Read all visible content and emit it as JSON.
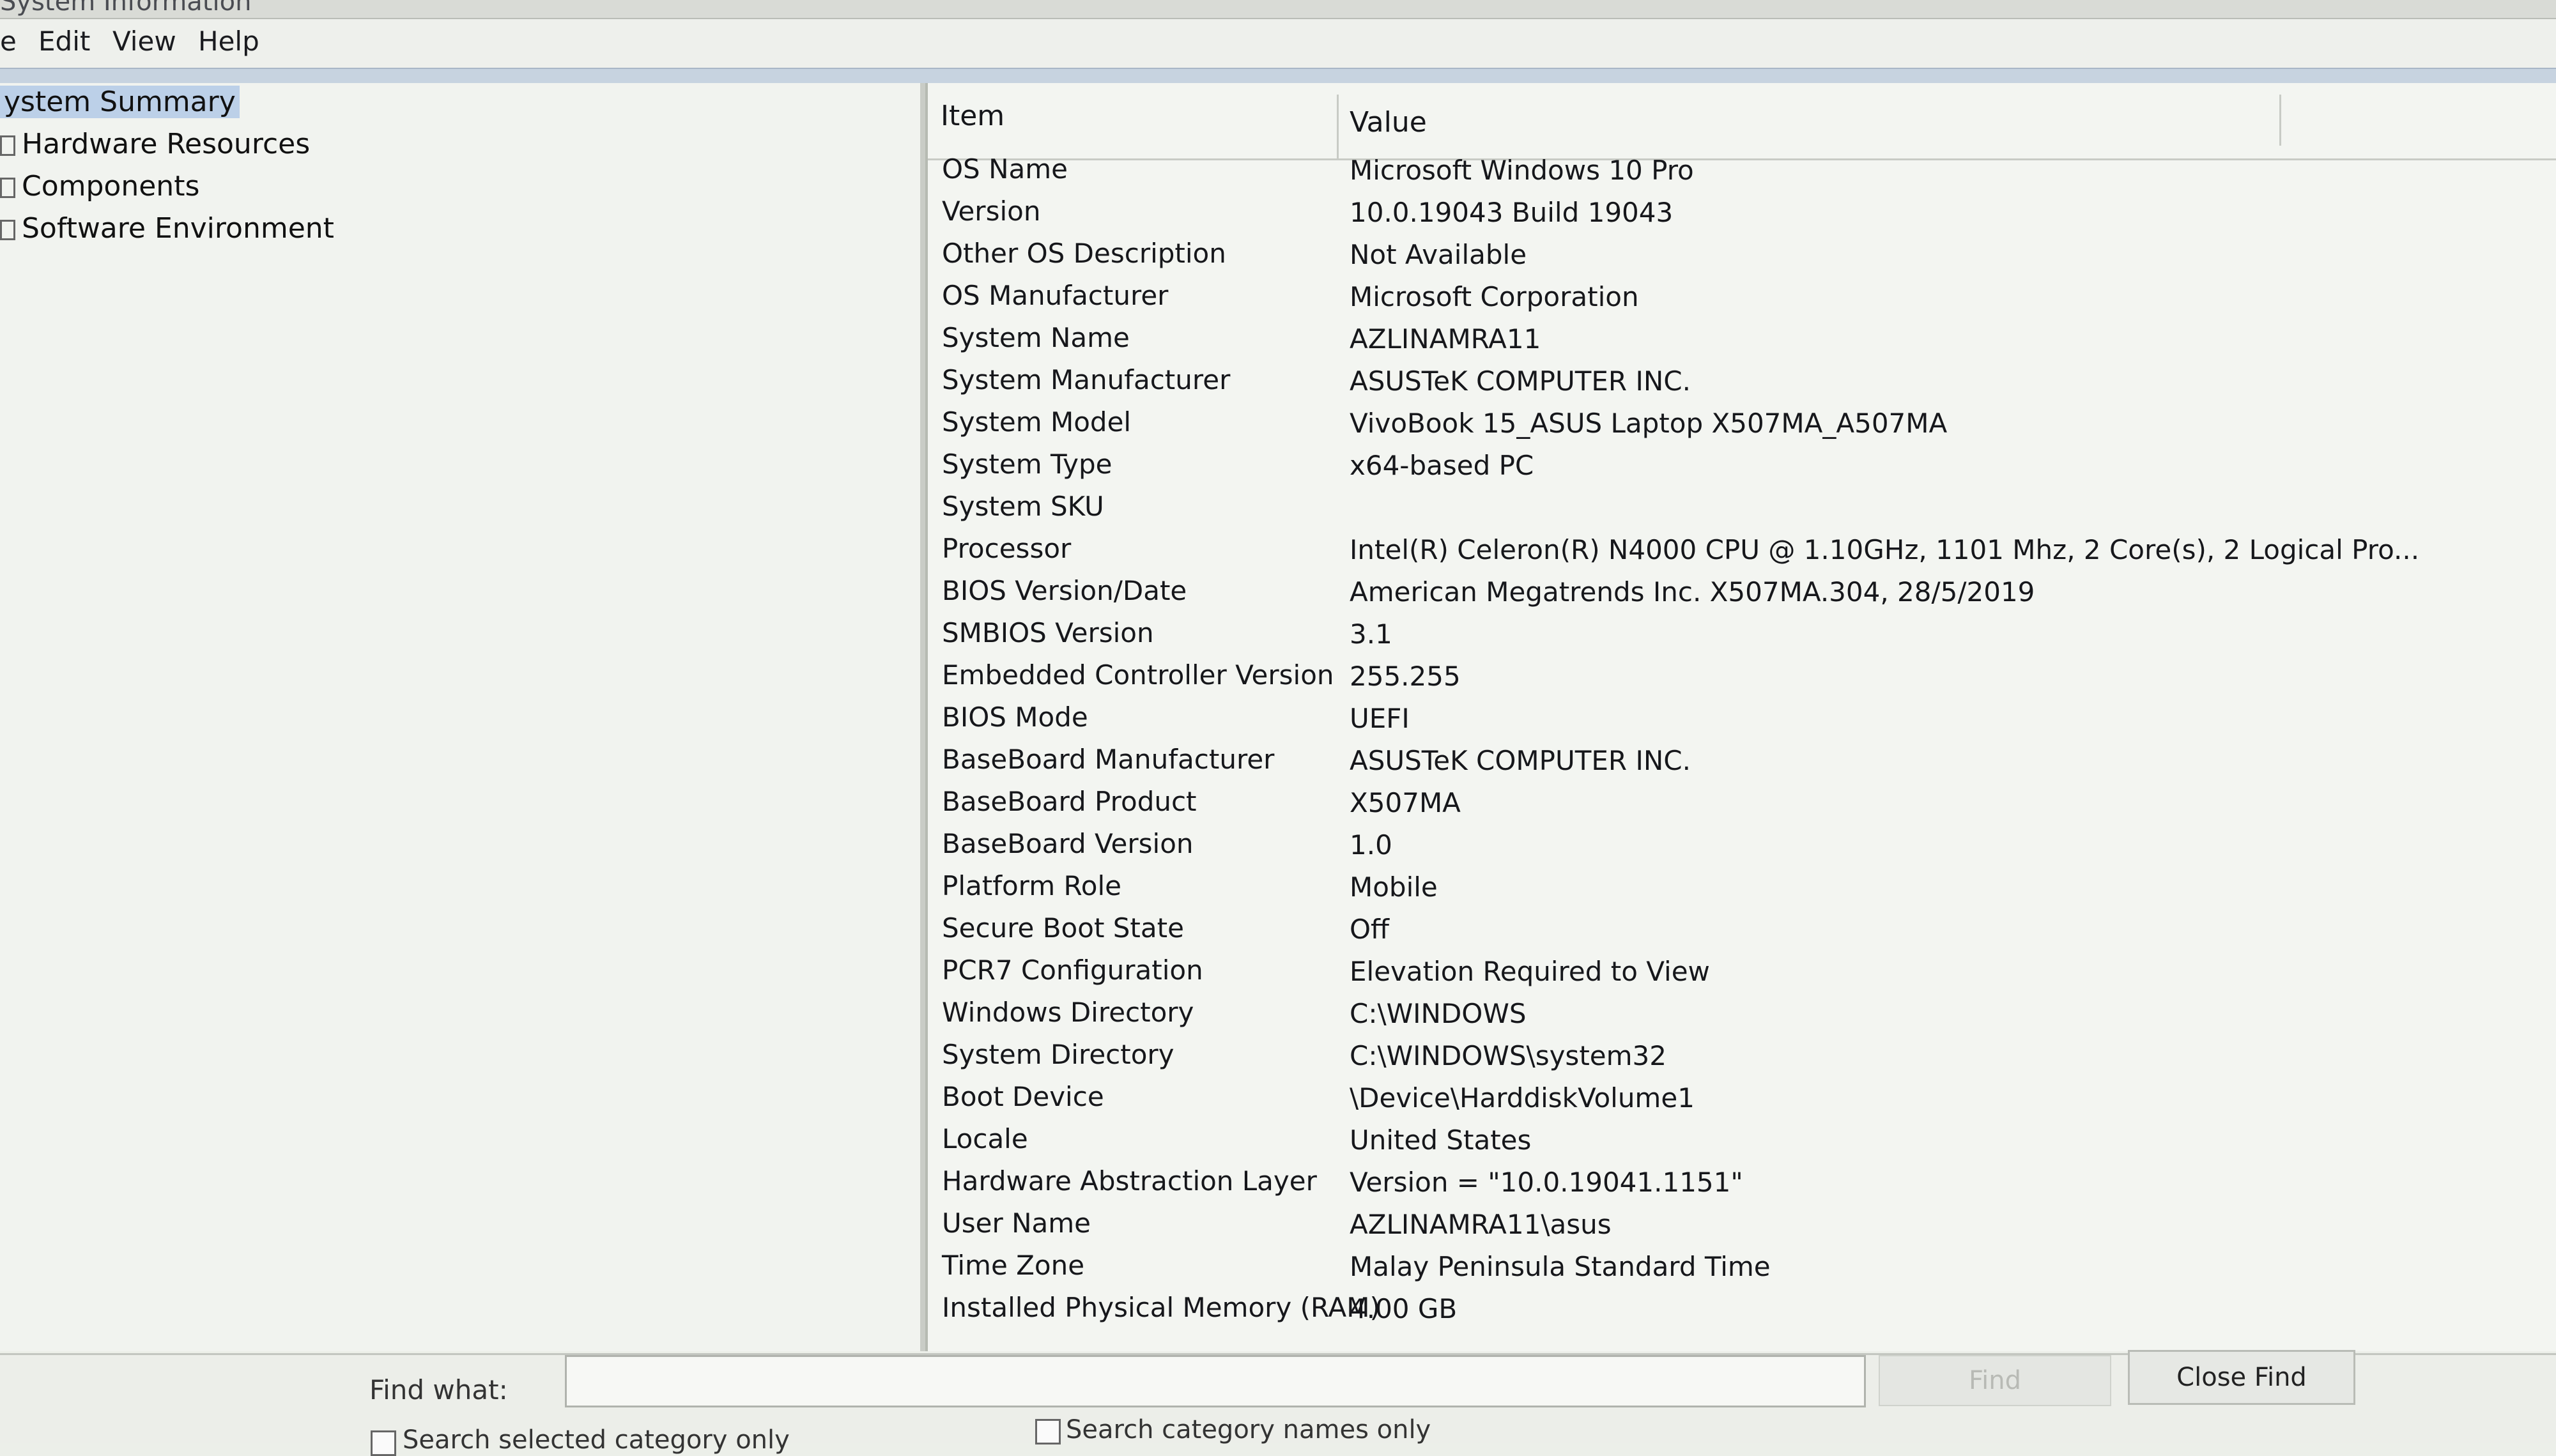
{
  "window": {
    "title": "System Information"
  },
  "menu": {
    "file": "e",
    "edit": "Edit",
    "view": "View",
    "help": "Help"
  },
  "tree": {
    "items": [
      {
        "label": "ystem Summary",
        "selected": true
      },
      {
        "label": "Hardware Resources",
        "selected": false
      },
      {
        "label": "Components",
        "selected": false
      },
      {
        "label": "Software Environment",
        "selected": false
      }
    ]
  },
  "list": {
    "headers": {
      "item": "Item",
      "value": "Value"
    },
    "rows": [
      {
        "item": "OS Name",
        "value": "Microsoft Windows 10 Pro"
      },
      {
        "item": "Version",
        "value": "10.0.19043 Build 19043"
      },
      {
        "item": "Other OS Description",
        "value": "Not Available"
      },
      {
        "item": "OS Manufacturer",
        "value": "Microsoft Corporation"
      },
      {
        "item": "System Name",
        "value": "AZLINAMRA11"
      },
      {
        "item": "System Manufacturer",
        "value": "ASUSTeK COMPUTER INC."
      },
      {
        "item": "System Model",
        "value": "VivoBook 15_ASUS Laptop X507MA_A507MA"
      },
      {
        "item": "System Type",
        "value": "x64-based PC"
      },
      {
        "item": "System SKU",
        "value": ""
      },
      {
        "item": "Processor",
        "value": "Intel(R) Celeron(R) N4000 CPU @ 1.10GHz, 1101 Mhz, 2 Core(s), 2 Logical Pro..."
      },
      {
        "item": "BIOS Version/Date",
        "value": "American Megatrends Inc. X507MA.304, 28/5/2019"
      },
      {
        "item": "SMBIOS Version",
        "value": "3.1"
      },
      {
        "item": "Embedded Controller Version",
        "value": "255.255"
      },
      {
        "item": "BIOS Mode",
        "value": "UEFI"
      },
      {
        "item": "BaseBoard Manufacturer",
        "value": "ASUSTeK COMPUTER INC."
      },
      {
        "item": "BaseBoard Product",
        "value": "X507MA"
      },
      {
        "item": "BaseBoard Version",
        "value": "1.0"
      },
      {
        "item": "Platform Role",
        "value": "Mobile"
      },
      {
        "item": "Secure Boot State",
        "value": "Off"
      },
      {
        "item": "PCR7 Configuration",
        "value": "Elevation Required to View"
      },
      {
        "item": "Windows Directory",
        "value": "C:\\WINDOWS"
      },
      {
        "item": "System Directory",
        "value": "C:\\WINDOWS\\system32"
      },
      {
        "item": "Boot Device",
        "value": "\\Device\\HarddiskVolume1"
      },
      {
        "item": "Locale",
        "value": "United States"
      },
      {
        "item": "Hardware Abstraction Layer",
        "value": "Version = \"10.0.19041.1151\""
      },
      {
        "item": "User Name",
        "value": "AZLINAMRA11\\asus"
      },
      {
        "item": "Time Zone",
        "value": "Malay Peninsula Standard Time"
      },
      {
        "item": "Installed Physical Memory (RAM)",
        "value": "4.00 GB"
      }
    ]
  },
  "find": {
    "label": "Find what:",
    "input_value": "",
    "find_button": "Find",
    "close_button": "Close Find",
    "search_selected_label": "Search selected category only",
    "search_names_label": "Search category names only"
  },
  "colors": {
    "selection": "#bcd0e8",
    "background": "#f3f5f1"
  },
  "icons": {
    "minimize": "minimize-icon",
    "tree_expander": "plus-box-icon"
  }
}
